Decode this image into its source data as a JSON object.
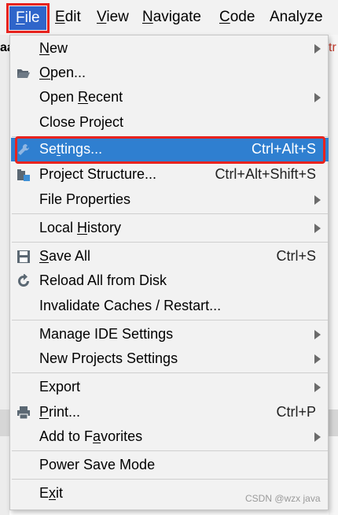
{
  "menubar": {
    "items": [
      {
        "label": "File",
        "mnemonic": "F",
        "rest": "ile"
      },
      {
        "label": "Edit",
        "mnemonic": "E",
        "rest": "dit"
      },
      {
        "label": "View",
        "mnemonic": "V",
        "rest": "iew"
      },
      {
        "label": "Navigate",
        "mnemonic": "N",
        "rest": "avigate"
      },
      {
        "label": "Code",
        "mnemonic": "C",
        "rest": "ode"
      },
      {
        "label": "Analyze",
        "mnemonic": "",
        "rest": "Analyze"
      }
    ]
  },
  "background": {
    "tab_left": "aa",
    "tab_right": "tr"
  },
  "menu": {
    "items": [
      {
        "pre": "",
        "u": "N",
        "post": "ew",
        "shortcut": ""
      },
      {
        "pre": "",
        "u": "O",
        "post": "pen...",
        "shortcut": ""
      },
      {
        "pre": "Open ",
        "u": "R",
        "post": "ecent",
        "shortcut": ""
      },
      {
        "pre": "Close Project",
        "u": "",
        "post": "",
        "shortcut": ""
      },
      {
        "pre": "Se",
        "u": "t",
        "post": "tings...",
        "shortcut": "Ctrl+Alt+S"
      },
      {
        "pre": "Project Structure...",
        "u": "",
        "post": "",
        "shortcut": "Ctrl+Alt+Shift+S"
      },
      {
        "pre": "File Properties",
        "u": "",
        "post": "",
        "shortcut": ""
      },
      {
        "pre": "Local ",
        "u": "H",
        "post": "istory",
        "shortcut": ""
      },
      {
        "pre": "",
        "u": "S",
        "post": "ave All",
        "shortcut": "Ctrl+S"
      },
      {
        "pre": "Reload All from Disk",
        "u": "",
        "post": "",
        "shortcut": ""
      },
      {
        "pre": "Invalidate Caches / Restart...",
        "u": "",
        "post": "",
        "shortcut": ""
      },
      {
        "pre": "Manage IDE Settings",
        "u": "",
        "post": "",
        "shortcut": ""
      },
      {
        "pre": "New Projects Settings",
        "u": "",
        "post": "",
        "shortcut": ""
      },
      {
        "pre": "Export",
        "u": "",
        "post": "",
        "shortcut": ""
      },
      {
        "pre": "",
        "u": "P",
        "post": "rint...",
        "shortcut": "Ctrl+P"
      },
      {
        "pre": "Add to F",
        "u": "a",
        "post": "vorites",
        "shortcut": ""
      },
      {
        "pre": "Power Save Mode",
        "u": "",
        "post": "",
        "shortcut": ""
      },
      {
        "pre": "E",
        "u": "x",
        "post": "it",
        "shortcut": ""
      }
    ]
  },
  "watermark": "CSDN @wzx java",
  "colors": {
    "highlight": "#2f7fd0",
    "annotation": "#e8231e",
    "menubar_active": "#2f65ca"
  }
}
